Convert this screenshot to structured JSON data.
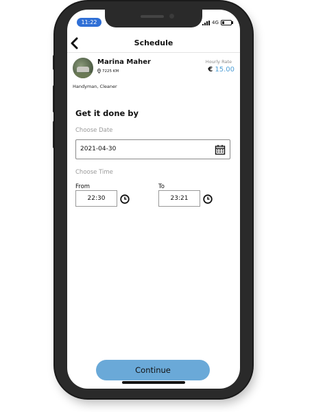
{
  "status_bar": {
    "time": "11:22",
    "network": "4G"
  },
  "header": {
    "title": "Schedule"
  },
  "provider": {
    "name": "Marina Maher",
    "distance": "7225 KM",
    "rate_label": "Hourly Rate",
    "currency": "€",
    "rate": "15.00",
    "services": "Handyman, Cleaner"
  },
  "schedule": {
    "heading": "Get it done by",
    "date_label": "Choose Date",
    "date_value": "2021-04-30",
    "time_label": "Choose Time",
    "from_label": "From",
    "from_value": "22:30",
    "to_label": "To",
    "to_value": "23:21"
  },
  "footer": {
    "continue_label": "Continue"
  },
  "colors": {
    "accent": "#6aa9d8",
    "rate": "#4f9fd6",
    "time_pill": "#2f6fd6"
  }
}
